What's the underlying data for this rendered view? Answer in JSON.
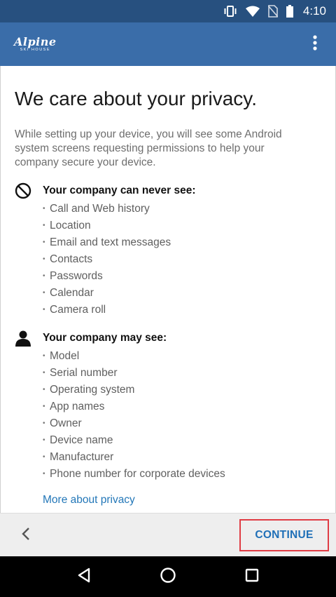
{
  "status_bar": {
    "time": "4:10",
    "icons": [
      "vibrate-icon",
      "wifi-icon",
      "no-sim-icon",
      "battery-icon"
    ]
  },
  "app_bar": {
    "logo_main": "Alpine",
    "logo_sub": "SKI HOUSE",
    "menu_icon": "overflow-menu-icon"
  },
  "main": {
    "title": "We care about your privacy.",
    "intro": "While setting up your device, you will see some Android system screens requesting permissions to help your company secure your device.",
    "never_see": {
      "icon": "prohibited-icon",
      "title": "Your company can never see:",
      "items": [
        "Call and Web history",
        "Location",
        "Email and text messages",
        "Contacts",
        "Passwords",
        "Calendar",
        "Camera roll"
      ]
    },
    "may_see": {
      "icon": "person-icon",
      "title": "Your company may see:",
      "items": [
        "Model",
        "Serial number",
        "Operating system",
        "App names",
        "Owner",
        "Device name",
        "Manufacturer",
        "Phone number for corporate devices"
      ]
    },
    "more_link": "More about privacy"
  },
  "footer": {
    "back_icon": "chevron-left-icon",
    "continue_label": "CONTINUE",
    "highlight_color": "#e03c44"
  },
  "nav_bar": {
    "icons": [
      "back-triangle-icon",
      "home-circle-icon",
      "recents-square-icon"
    ]
  },
  "colors": {
    "status_bar": "#27507f",
    "app_bar": "#3a6da9",
    "link": "#2377b8",
    "accent_button_text": "#1f6fb7"
  }
}
